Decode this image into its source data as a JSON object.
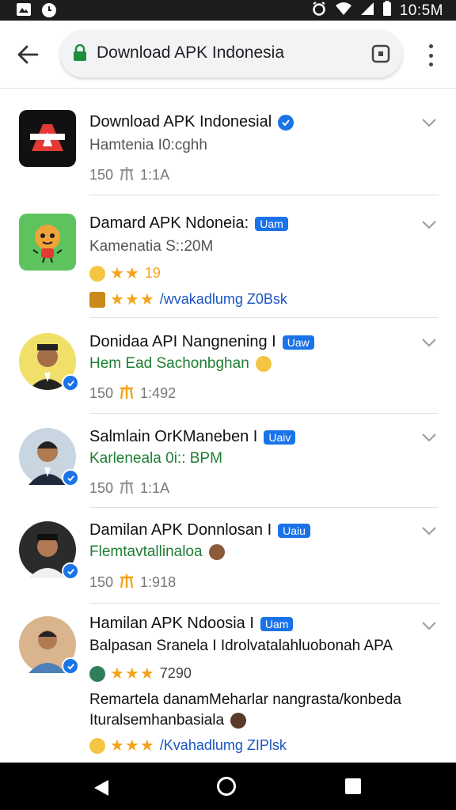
{
  "status_bar": {
    "time": "10:5M"
  },
  "toolbar": {
    "url": "Download APK Indonesia"
  },
  "items": [
    {
      "title": "Download APK Indonesial",
      "subtitle": "Hamtenia I0:cghh",
      "meta_count": "150",
      "meta_value": "1:1A"
    },
    {
      "title": "Damard APK Ndoneia:",
      "badge": "Uam",
      "subtitle": "Kamenatia S::20M",
      "rating_value": "19",
      "link_text": "/wvakadlumg Z0Bsk"
    },
    {
      "title": "Donidaa API Nangnening I",
      "badge": "Uaw",
      "subtitle": "Hem Ead Sachonbghan",
      "meta_count": "150",
      "meta_value": "1:492"
    },
    {
      "title": "Salmlain OrKManeben I",
      "badge": "Uaiv",
      "subtitle": "Karleneala 0i:: BPM",
      "meta_count": "150",
      "meta_value": "1:1A"
    },
    {
      "title": "Damilan APK Donnlosan I",
      "badge": "Uaiu",
      "subtitle": "Flemtavtallinaloa",
      "meta_count": "150",
      "meta_value": "1:918"
    },
    {
      "title": "Hamilan APK Ndoosia I",
      "badge": "Uam",
      "subtitle": "Balpasan Sranela I Idrolvatalahluobonah APA",
      "rating_value": "7290",
      "desc_line1": "Remartela danamMeharlar nangrasta/konbeda",
      "desc_line2": "Ituralsemhanbasiala",
      "link_text": "/Kvahadlumg ZIPlsk"
    }
  ],
  "colors": {
    "verified": "#1a73e8",
    "link": "#1a55c0",
    "star": "#f4a41b",
    "green_text": "#1e7e34"
  }
}
